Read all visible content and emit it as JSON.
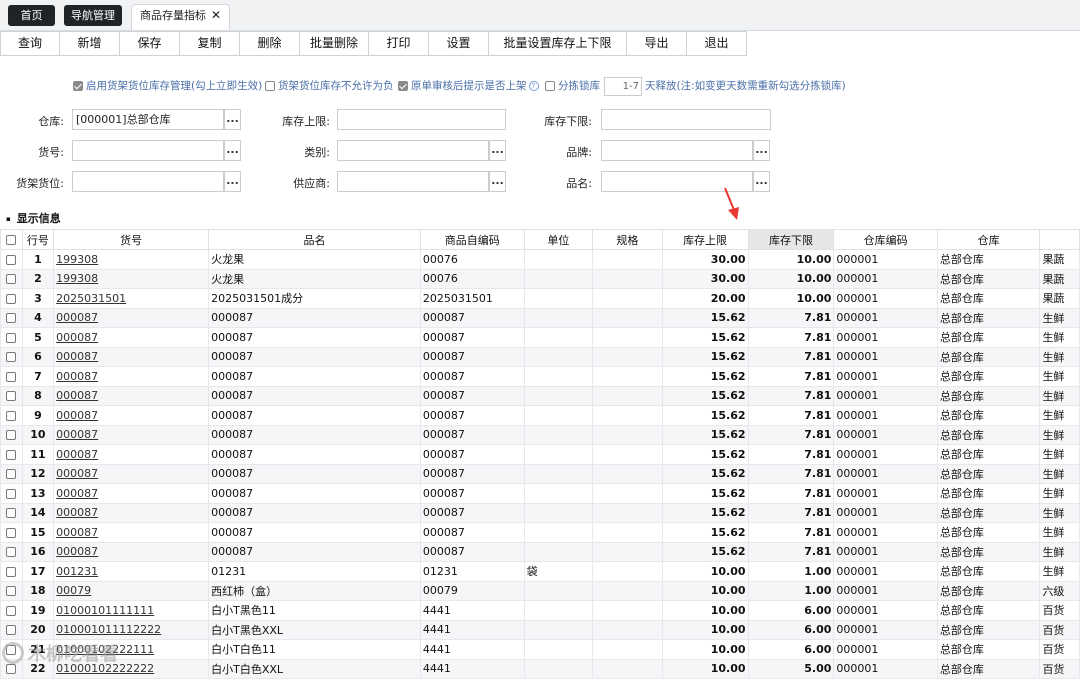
{
  "tabs": [
    {
      "label": "首页"
    },
    {
      "label": "导航管理"
    },
    {
      "label": "商品存量指标"
    }
  ],
  "toolbar": {
    "buttons": [
      "查询",
      "新增",
      "保存",
      "复制",
      "删除",
      "批量删除",
      "打印",
      "设置",
      "批量设置库存上下限",
      "导出",
      "退出"
    ]
  },
  "options": {
    "opt1": "启用货架货位库存管理(勾上立即生效)",
    "opt2": "货架货位库存不允许为负",
    "opt3": "原单审核后提示是否上架",
    "opt4": "分拣锁库",
    "days_value": "1-7",
    "opt4_suffix": "天释放(注:如变更天数需重新勾选分拣锁库)"
  },
  "form": {
    "warehouse_label": "仓库:",
    "warehouse_value": "[000001]总部仓库",
    "upper_label": "库存上限:",
    "lower_label": "库存下限:",
    "item_no_label": "货号:",
    "category_label": "类别:",
    "brand_label": "品牌:",
    "shelf_label": "货架货位:",
    "supplier_label": "供应商:",
    "name_label": "品名:"
  },
  "section_title": "显示信息",
  "table": {
    "headers": [
      "行号",
      "货号",
      "品名",
      "商品自编码",
      "单位",
      "规格",
      "库存上限",
      "库存下限",
      "仓库编码",
      "仓库",
      ""
    ],
    "rows": [
      [
        "1",
        "199308",
        "火龙果",
        "00076",
        "",
        "",
        "30.00",
        "10.00",
        "000001",
        "总部仓库",
        "果蔬"
      ],
      [
        "2",
        "199308",
        "火龙果",
        "00076",
        "",
        "",
        "30.00",
        "10.00",
        "000001",
        "总部仓库",
        "果蔬"
      ],
      [
        "3",
        "2025031501",
        "2025031501成分",
        "2025031501",
        "",
        "",
        "20.00",
        "10.00",
        "000001",
        "总部仓库",
        "果蔬"
      ],
      [
        "4",
        "000087",
        "000087",
        "000087",
        "",
        "",
        "15.62",
        "7.81",
        "000001",
        "总部仓库",
        "生鲜"
      ],
      [
        "5",
        "000087",
        "000087",
        "000087",
        "",
        "",
        "15.62",
        "7.81",
        "000001",
        "总部仓库",
        "生鲜"
      ],
      [
        "6",
        "000087",
        "000087",
        "000087",
        "",
        "",
        "15.62",
        "7.81",
        "000001",
        "总部仓库",
        "生鲜"
      ],
      [
        "7",
        "000087",
        "000087",
        "000087",
        "",
        "",
        "15.62",
        "7.81",
        "000001",
        "总部仓库",
        "生鲜"
      ],
      [
        "8",
        "000087",
        "000087",
        "000087",
        "",
        "",
        "15.62",
        "7.81",
        "000001",
        "总部仓库",
        "生鲜"
      ],
      [
        "9",
        "000087",
        "000087",
        "000087",
        "",
        "",
        "15.62",
        "7.81",
        "000001",
        "总部仓库",
        "生鲜"
      ],
      [
        "10",
        "000087",
        "000087",
        "000087",
        "",
        "",
        "15.62",
        "7.81",
        "000001",
        "总部仓库",
        "生鲜"
      ],
      [
        "11",
        "000087",
        "000087",
        "000087",
        "",
        "",
        "15.62",
        "7.81",
        "000001",
        "总部仓库",
        "生鲜"
      ],
      [
        "12",
        "000087",
        "000087",
        "000087",
        "",
        "",
        "15.62",
        "7.81",
        "000001",
        "总部仓库",
        "生鲜"
      ],
      [
        "13",
        "000087",
        "000087",
        "000087",
        "",
        "",
        "15.62",
        "7.81",
        "000001",
        "总部仓库",
        "生鲜"
      ],
      [
        "14",
        "000087",
        "000087",
        "000087",
        "",
        "",
        "15.62",
        "7.81",
        "000001",
        "总部仓库",
        "生鲜"
      ],
      [
        "15",
        "000087",
        "000087",
        "000087",
        "",
        "",
        "15.62",
        "7.81",
        "000001",
        "总部仓库",
        "生鲜"
      ],
      [
        "16",
        "000087",
        "000087",
        "000087",
        "",
        "",
        "15.62",
        "7.81",
        "000001",
        "总部仓库",
        "生鲜"
      ],
      [
        "17",
        "001231",
        "01231",
        "01231",
        "袋",
        "",
        "10.00",
        "1.00",
        "000001",
        "总部仓库",
        "生鲜"
      ],
      [
        "18",
        "00079",
        "西红柿（盒）",
        "00079",
        "",
        "",
        "10.00",
        "1.00",
        "000001",
        "总部仓库",
        "六级"
      ],
      [
        "19",
        "01000101111111",
        "白小T黑色11",
        "4441",
        "",
        "",
        "10.00",
        "6.00",
        "000001",
        "总部仓库",
        "百货"
      ],
      [
        "20",
        "010001011112222",
        "白小T黑色XXL",
        "4441",
        "",
        "",
        "10.00",
        "6.00",
        "000001",
        "总部仓库",
        "百货"
      ],
      [
        "21",
        "01000102222111",
        "白小T白色11",
        "4441",
        "",
        "",
        "10.00",
        "6.00",
        "000001",
        "总部仓库",
        "百货"
      ],
      [
        "22",
        "01000102222222",
        "白小T白色XXL",
        "4441",
        "",
        "",
        "10.00",
        "5.00",
        "000001",
        "总部仓库",
        "百货"
      ]
    ]
  },
  "watermark": "木柳吃看看",
  "colors": {
    "accent_arrow": "#e8382f",
    "option_text": "#4a6fa8"
  }
}
